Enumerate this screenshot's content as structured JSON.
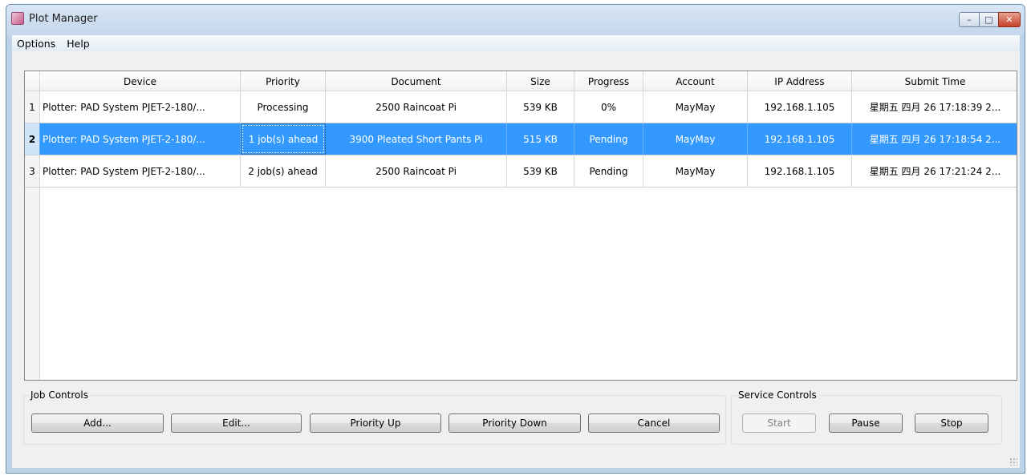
{
  "window": {
    "title": "Plot Manager",
    "icon": "plot-manager-app-icon",
    "controls": {
      "minimize": "–",
      "maximize": "□",
      "close": "✕"
    }
  },
  "menu": [
    {
      "label": "Options"
    },
    {
      "label": "Help"
    }
  ],
  "table": {
    "columns": [
      "Device",
      "Priority",
      "Document",
      "Size",
      "Progress",
      "Account",
      "IP Address",
      "Submit Time"
    ],
    "rows": [
      {
        "num": "1",
        "device": "Plotter: PAD System PJET-2-180/...",
        "priority": "Processing",
        "document": "2500 Raincoat Pi",
        "size": "539 KB",
        "progress": "0%",
        "account": "MayMay",
        "ip": "192.168.1.105",
        "submit": "星期五 四月 26 17:18:39 2..."
      },
      {
        "num": "2",
        "device": "Plotter: PAD System PJET-2-180/...",
        "priority": "1 job(s) ahead",
        "document": "3900 Pleated Short Pants Pi",
        "size": "515 KB",
        "progress": "Pending",
        "account": "MayMay",
        "ip": "192.168.1.105",
        "submit": "星期五 四月 26 17:18:54 2..."
      },
      {
        "num": "3",
        "device": "Plotter: PAD System PJET-2-180/...",
        "priority": "2 job(s) ahead",
        "document": "2500 Raincoat Pi",
        "size": "539 KB",
        "progress": "Pending",
        "account": "MayMay",
        "ip": "192.168.1.105",
        "submit": "星期五 四月 26 17:21:24 2..."
      }
    ],
    "selected_row": 2
  },
  "job_controls": {
    "label": "Job Controls",
    "add": "Add...",
    "edit": "Edit...",
    "priority_up": "Priority Up",
    "priority_down": "Priority Down",
    "cancel": "Cancel"
  },
  "service_controls": {
    "label": "Service Controls",
    "start": "Start",
    "pause": "Pause",
    "stop": "Stop"
  },
  "colors": {
    "selection": "#3399ff",
    "titlebar": "#c3d6ec",
    "close_button": "#c7412b"
  }
}
